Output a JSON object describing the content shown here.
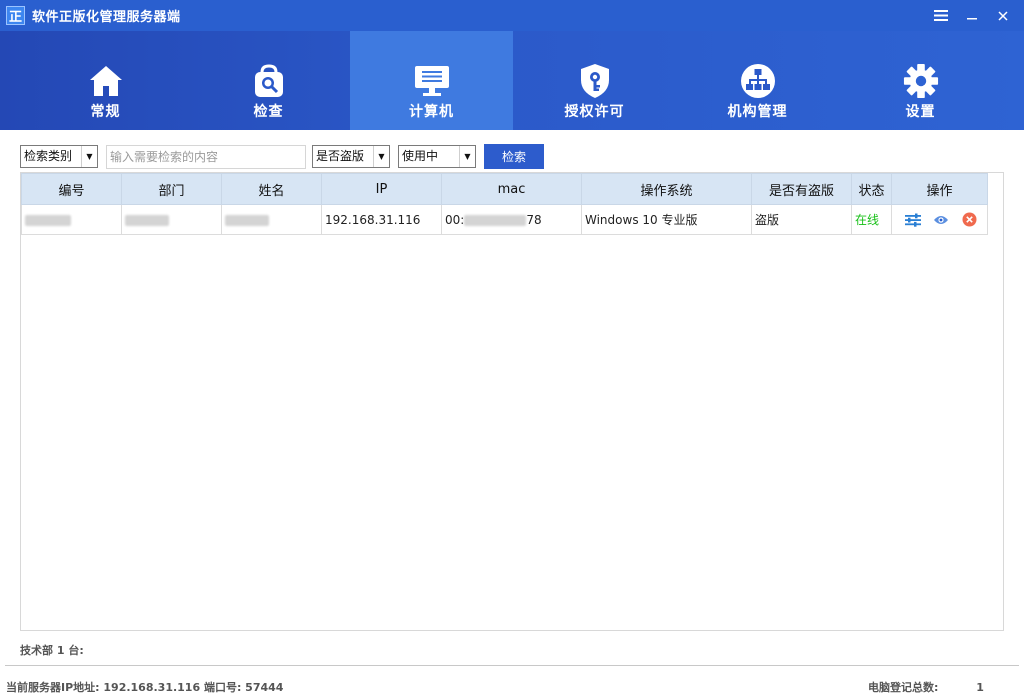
{
  "window": {
    "logo_char": "正",
    "title": "软件正版化管理服务器端",
    "controls": {
      "menu": "≡",
      "minimize": "—",
      "close": "✕"
    }
  },
  "nav": {
    "items": [
      {
        "label": "常规",
        "icon": "home-icon"
      },
      {
        "label": "检查",
        "icon": "search-bag-icon"
      },
      {
        "label": "计算机",
        "icon": "monitor-icon",
        "active": true
      },
      {
        "label": "授权许可",
        "icon": "key-shield-icon"
      },
      {
        "label": "机构管理",
        "icon": "org-chart-icon"
      },
      {
        "label": "设置",
        "icon": "gear-icon"
      }
    ]
  },
  "search": {
    "category": "检索类别",
    "placeholder": "输入需要检索的内容",
    "pirated_filter": "是否盗版",
    "usage_filter": "使用中",
    "button": "检索"
  },
  "table": {
    "columns": [
      "编号",
      "部门",
      "姓名",
      "IP",
      "mac",
      "操作系统",
      "是否有盗版",
      "状态",
      "操作"
    ],
    "rows": [
      {
        "ip": "192.168.31.116",
        "mac_visible": "00:",
        "mac_tail": "78",
        "os": "Windows 10 专业版",
        "pirated": "盗版",
        "status": "在线"
      }
    ]
  },
  "footer": {
    "dept_count": "技术部 1 台:",
    "server_info": "当前服务器IP地址: 192.168.31.116  端口号: 57444",
    "total_label": "电脑登记总数:",
    "total_value": "1"
  },
  "colors": {
    "titlebar": "#2a5fcf",
    "nav_active": "#3f7ae0",
    "header_row": "#d7e5f4",
    "online": "#17c017",
    "button": "#2d5ccc"
  }
}
